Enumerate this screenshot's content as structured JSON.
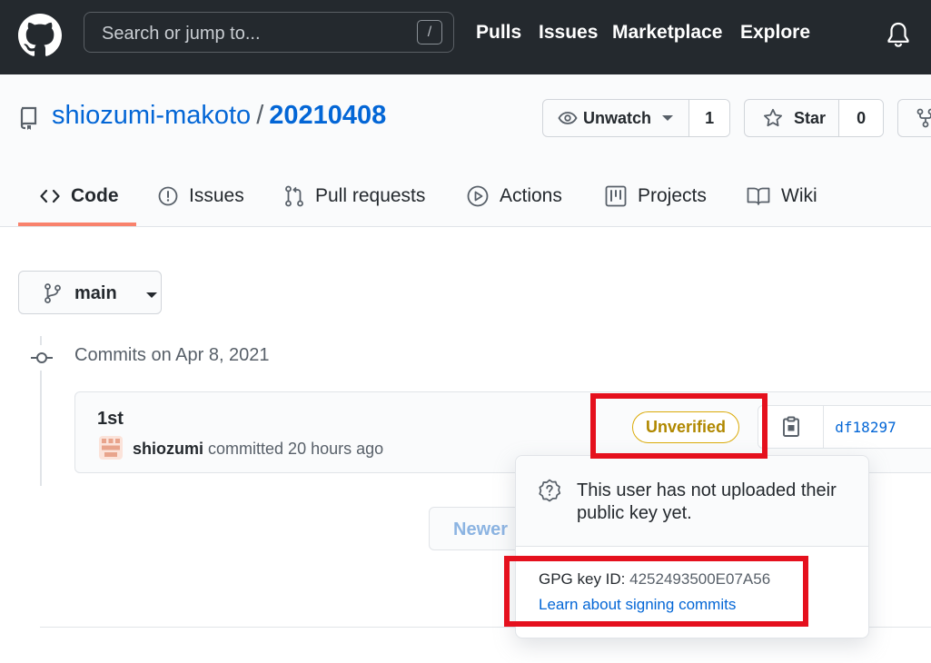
{
  "header": {
    "search_placeholder": "Search or jump to...",
    "search_shortcut": "/",
    "nav": [
      "Pulls",
      "Issues",
      "Marketplace",
      "Explore"
    ]
  },
  "repo": {
    "owner": "shiozumi-makoto",
    "separator": "/",
    "name": "20210408",
    "watch_label": "Unwatch",
    "watch_count": "1",
    "star_label": "Star",
    "star_count": "0"
  },
  "tabs": [
    {
      "label": "Code",
      "icon": "code-icon",
      "selected": true
    },
    {
      "label": "Issues",
      "icon": "issue-icon"
    },
    {
      "label": "Pull requests",
      "icon": "pull-request-icon"
    },
    {
      "label": "Actions",
      "icon": "play-icon"
    },
    {
      "label": "Projects",
      "icon": "project-icon"
    },
    {
      "label": "Wiki",
      "icon": "book-icon"
    }
  ],
  "branch": {
    "label": "main"
  },
  "commits": {
    "date_heading": "Commits on Apr 8, 2021",
    "items": [
      {
        "message": "1st",
        "author": "shiozumi",
        "meta": "committed 20 hours ago",
        "badge": "Unverified",
        "sha": "df18297"
      }
    ]
  },
  "pagination": {
    "newer_label": "Newer"
  },
  "popover": {
    "message": "This user has not uploaded their public key yet.",
    "gpg_label": "GPG key ID: ",
    "gpg_value": "4252493500E07A56",
    "link": "Learn about signing commits"
  },
  "colors": {
    "header_bg": "#24292e",
    "link": "#0366d6",
    "tab_underline": "#f9826c",
    "unverified": "#b08800",
    "highlight": "#e5101d"
  }
}
